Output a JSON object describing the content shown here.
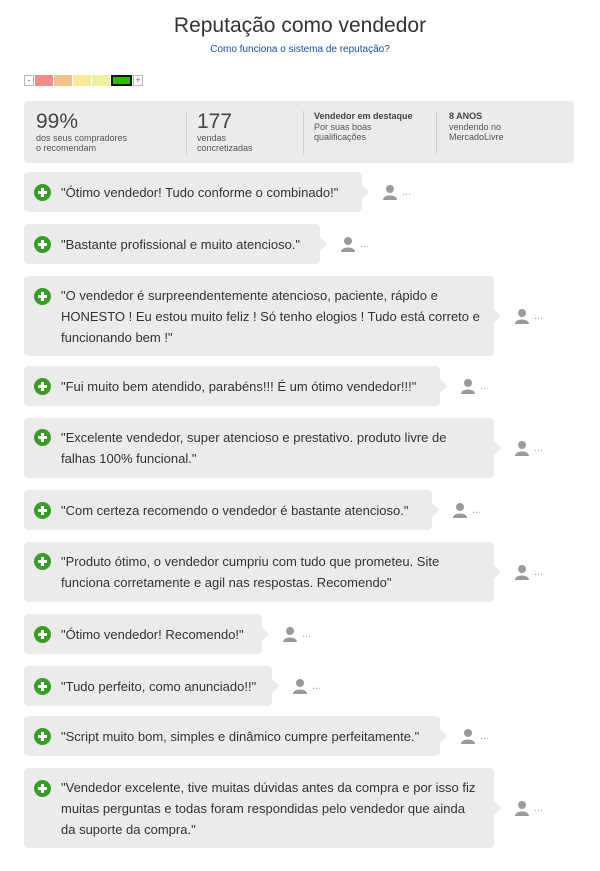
{
  "header": {
    "title": "Reputação como vendedor",
    "subtitle_link": "Como funciona o sistema de reputação?"
  },
  "thermometer": {
    "minus": "-",
    "plus": "+",
    "levels": [
      "#f08c8c",
      "#f7c28a",
      "#fbe89a",
      "#eef2a0",
      "#31b800"
    ],
    "active_level": 5
  },
  "stats": {
    "recommend_pct": "99%",
    "recommend_line1": "dos seus compradores",
    "recommend_line2": "o recomendam",
    "sales_count": "177",
    "sales_line1": "vendas",
    "sales_line2": "concretizadas",
    "highlight_title": "Vendedor em destaque",
    "highlight_line1": "Por suas boas",
    "highlight_line2": "qualificações",
    "years_title": "8 ANOS",
    "years_line1": "vendendo no",
    "years_line2": "MercadoLivre"
  },
  "reviews": [
    {
      "text": "\"Ótimo vendedor! Tudo conforme o combinado!\"",
      "rating": "positive"
    },
    {
      "text": "\"Bastante profissional e muito atencioso.\"",
      "rating": "positive"
    },
    {
      "text": "\"O vendedor é surpreendentemente atencioso, paciente, rápido e HONESTO ! Eu estou muito feliz ! Só tenho elogios ! Tudo está correto e funcionando bem !\"",
      "rating": "positive"
    },
    {
      "text": "\"Fui muito bem atendido, parabéns!!! É um ótimo vendedor!!!\"",
      "rating": "positive"
    },
    {
      "text": "\"Excelente vendedor, super atencioso e prestativo. produto livre de falhas 100% funcional.\"",
      "rating": "positive"
    },
    {
      "text": "\"Com certeza recomendo o vendedor é bastante atencioso.\"",
      "rating": "positive"
    },
    {
      "text": "\"Produto ótimo, o vendedor cumpriu com tudo que prometeu. Site funciona corretamente e agil nas respostas. Recomendo\"",
      "rating": "positive"
    },
    {
      "text": "\"Ótimo vendedor! Recomendo!\"",
      "rating": "positive"
    },
    {
      "text": "\"Tudo perfeito, como anunciado!!\"",
      "rating": "positive"
    },
    {
      "text": "\"Script muito bom, simples e dinâmico cumpre perfeitamente.\"",
      "rating": "positive"
    },
    {
      "text": "\"Vendedor excelente, tive muitas dúvidas antes da compra e por isso fiz muitas perguntas e todas foram respondidas pelo vendedor que ainda da suporte da compra.\"",
      "rating": "positive"
    }
  ],
  "reviewer_suffix": "...",
  "icons": {
    "positive": "plus-circle-icon",
    "reviewer": "user-silhouette-icon"
  }
}
